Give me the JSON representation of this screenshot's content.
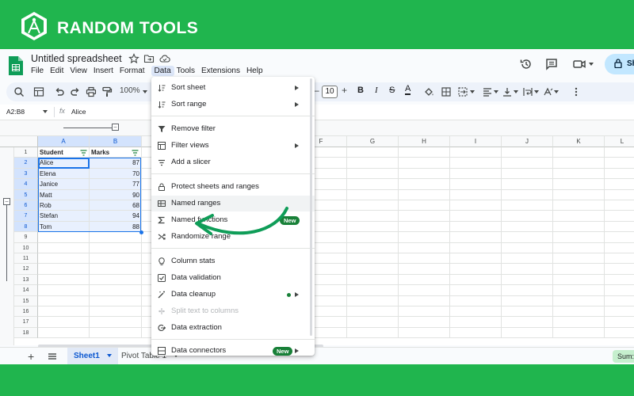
{
  "banner": {
    "brand": "RANDOM TOOLS",
    "background": "#20b54e"
  },
  "header": {
    "doc_title": "Untitled spreadsheet",
    "menu": [
      "File",
      "Edit",
      "View",
      "Insert",
      "Format",
      "Data",
      "Tools",
      "Extensions",
      "Help"
    ],
    "active_menu": "Data",
    "share_label": "Sh"
  },
  "toolbar": {
    "zoom": "100%",
    "font_size": "10"
  },
  "formula_bar": {
    "name_box": "A2:B8",
    "fx": "fx",
    "value": "Alice"
  },
  "grid": {
    "columns": [
      "A",
      "B",
      "F",
      "G",
      "H",
      "I",
      "J",
      "K",
      "L"
    ],
    "row_numbers": [
      "1",
      "2",
      "3",
      "4",
      "5",
      "6",
      "7",
      "8",
      "9",
      "10",
      "11",
      "12",
      "13",
      "14",
      "15",
      "16",
      "17",
      "18"
    ],
    "headers": [
      "Student",
      "Marks"
    ],
    "rows": [
      {
        "student": "Alice",
        "marks": "87"
      },
      {
        "student": "Elena",
        "marks": "70"
      },
      {
        "student": "Janice",
        "marks": "77"
      },
      {
        "student": "Matt",
        "marks": "90"
      },
      {
        "student": "Rob",
        "marks": "68"
      },
      {
        "student": "Stefan",
        "marks": "94"
      },
      {
        "student": "Tom",
        "marks": "88"
      }
    ]
  },
  "data_menu": {
    "items": [
      {
        "label": "Sort sheet",
        "icon": "sort-icon",
        "submenu": true
      },
      {
        "label": "Sort range",
        "icon": "sort-icon",
        "submenu": true
      },
      {
        "label": "Remove filter",
        "icon": "filter-icon"
      },
      {
        "label": "Filter views",
        "icon": "filter-views-icon",
        "submenu": true
      },
      {
        "label": "Add a slicer",
        "icon": "slicer-icon"
      },
      {
        "label": "Protect sheets and ranges",
        "icon": "lock-icon"
      },
      {
        "label": "Named ranges",
        "icon": "named-ranges-icon"
      },
      {
        "label": "Named functions",
        "icon": "sigma-icon",
        "badge": "New"
      },
      {
        "label": "Randomize range",
        "icon": "shuffle-icon"
      },
      {
        "label": "Column stats",
        "icon": "bulb-icon"
      },
      {
        "label": "Data validation",
        "icon": "validation-icon"
      },
      {
        "label": "Data cleanup",
        "icon": "wand-icon",
        "submenu": true,
        "dot": true
      },
      {
        "label": "Split text to columns",
        "icon": "split-icon",
        "disabled": true
      },
      {
        "label": "Data extraction",
        "icon": "extraction-icon"
      },
      {
        "label": "Data connectors",
        "icon": "database-icon",
        "badge": "New",
        "submenu": true
      }
    ]
  },
  "sheet_tabs": {
    "tabs": [
      "Sheet1",
      "Pivot Table 1"
    ],
    "active": "Sheet1",
    "sum_label": "Sum:"
  },
  "colors": {
    "brand_green": "#20b54e",
    "selection_blue": "#1a73e8",
    "badge_green": "#188038",
    "annotation_arrow": "#0f9d58"
  }
}
